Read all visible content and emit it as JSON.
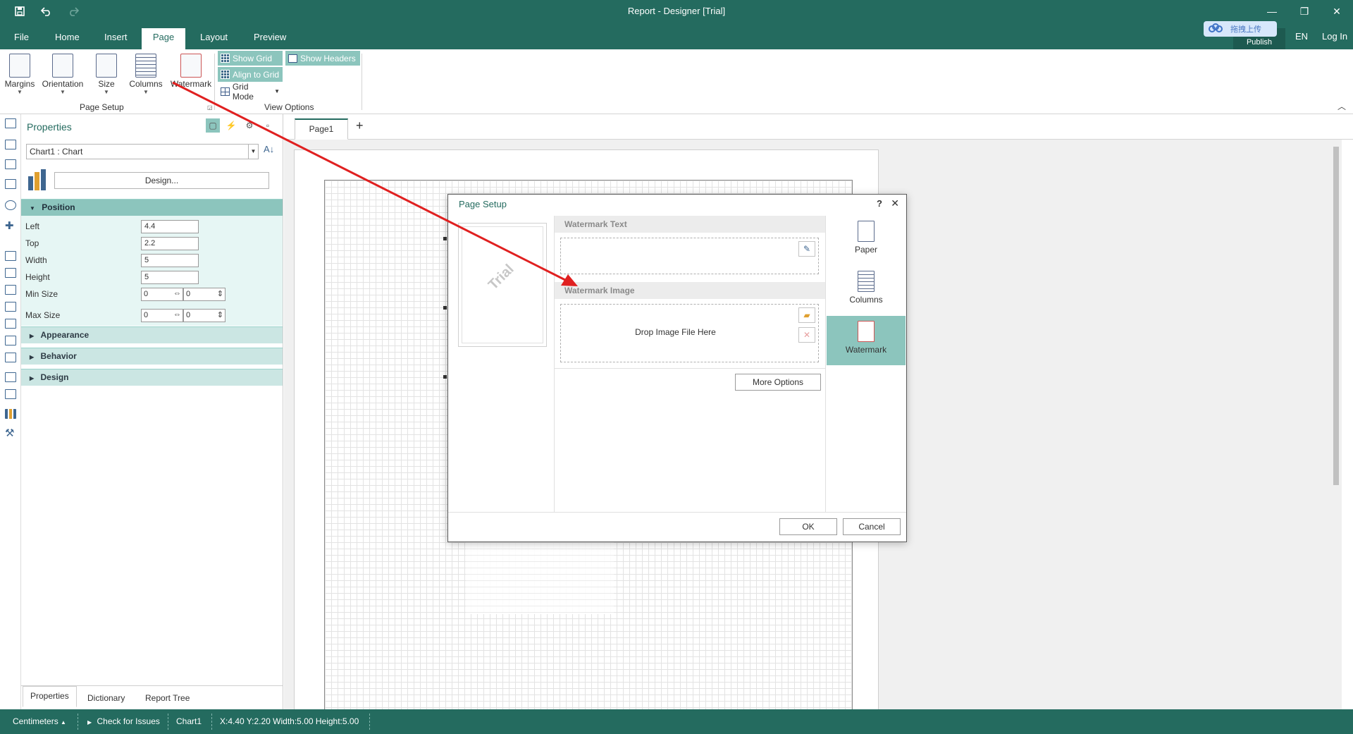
{
  "window": {
    "title": "Report - Designer [Trial]",
    "minimize": "—",
    "restore": "❐",
    "close": "✕"
  },
  "menu": {
    "tabs": [
      "File",
      "Home",
      "Insert",
      "Page",
      "Layout",
      "Preview"
    ],
    "active": "Page",
    "publish_badge": "拖拽上传",
    "publish_label": "Publish",
    "language": "EN",
    "login": "Log In"
  },
  "ribbon": {
    "page_setup": {
      "buttons": [
        "Margins",
        "Orientation",
        "Size",
        "Columns",
        "Watermark"
      ],
      "group_label": "Page Setup"
    },
    "view_options": {
      "show_grid": "Show Grid",
      "align_to_grid": "Align to Grid",
      "grid_mode": "Grid Mode",
      "show_headers": "Show Headers",
      "group_label": "View Options"
    }
  },
  "properties": {
    "title": "Properties",
    "object_selector": "Chart1 : Chart",
    "design_button": "Design...",
    "categories": {
      "position": "Position",
      "appearance": "Appearance",
      "behavior": "Behavior",
      "design": "Design"
    },
    "fields": {
      "left": {
        "label": "Left",
        "value": "4.4"
      },
      "top": {
        "label": "Top",
        "value": "2.2"
      },
      "width": {
        "label": "Width",
        "value": "5"
      },
      "height": {
        "label": "Height",
        "value": "5"
      },
      "min_size": {
        "label": "Min Size",
        "w": "0",
        "h": "0"
      },
      "max_size": {
        "label": "Max Size",
        "w": "0",
        "h": "0"
      }
    },
    "bottom_tabs": [
      "Properties",
      "Dictionary",
      "Report Tree"
    ]
  },
  "pages": {
    "tabs": [
      "Page1"
    ],
    "add": "+"
  },
  "dialog": {
    "title": "Page Setup",
    "help": "?",
    "close": "✕",
    "preview_text": "Trial",
    "watermark_text_header": "Watermark Text",
    "watermark_image_header": "Watermark Image",
    "drop_text": "Drop Image File Here",
    "more_options": "More Options",
    "ok": "OK",
    "cancel": "Cancel",
    "nav": [
      "Paper",
      "Columns",
      "Watermark"
    ],
    "nav_active": "Watermark"
  },
  "statusbar": {
    "units": "Centimeters",
    "check": "Check for Issues",
    "component": "Chart1",
    "position": "X:4.40 Y:2.20 Width:5.00 Height:5.00"
  },
  "colors": {
    "brand": "#246b5f",
    "highlight": "#8cc5bd",
    "annotation_arrow": "#e02020"
  }
}
